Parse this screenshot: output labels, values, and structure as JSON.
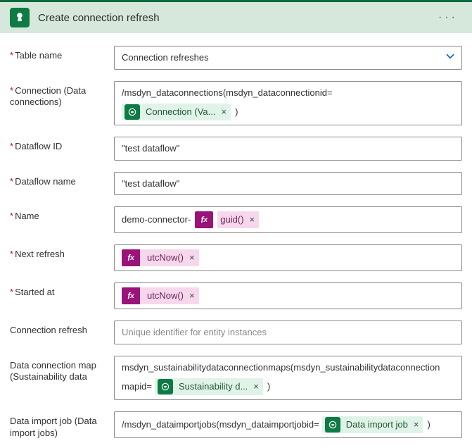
{
  "header": {
    "title": "Create connection refresh",
    "more_label": "···"
  },
  "labels": {
    "table_name": "Table name",
    "connection": "Connection (Data connections)",
    "dataflow_id": "Dataflow ID",
    "dataflow_name": "Dataflow name",
    "name": "Name",
    "next_refresh": "Next refresh",
    "started_at": "Started at",
    "connection_refresh": "Connection refresh",
    "data_connection_map": "Data connection map (Sustainability data",
    "data_import_job": "Data import job (Data import jobs)"
  },
  "values": {
    "table_name": "Connection refreshes",
    "connection_prefix": "/msdyn_dataconnections(msdyn_dataconnectionid=",
    "connection_token": "Connection (Va...",
    "connection_suffix": ")",
    "dataflow_id": "\"test dataflow\"",
    "dataflow_name": "\"test dataflow\"",
    "name_prefix": "demo-connector-",
    "name_expr": "guid()",
    "next_refresh_expr": "utcNow()",
    "started_at_expr": "utcNow()",
    "connection_refresh_placeholder": "Unique identifier for entity instances",
    "map_line1": "msdyn_sustainabilitydataconnectionmaps(msdyn_sustainabilitydataconnection",
    "map_line2_prefix": "mapid=",
    "map_token": "Sustainability d...",
    "map_suffix": ")",
    "import_prefix": "/msdyn_dataimportjobs(msdyn_dataimportjobid=",
    "import_token": "Data import job",
    "import_suffix": ")"
  }
}
